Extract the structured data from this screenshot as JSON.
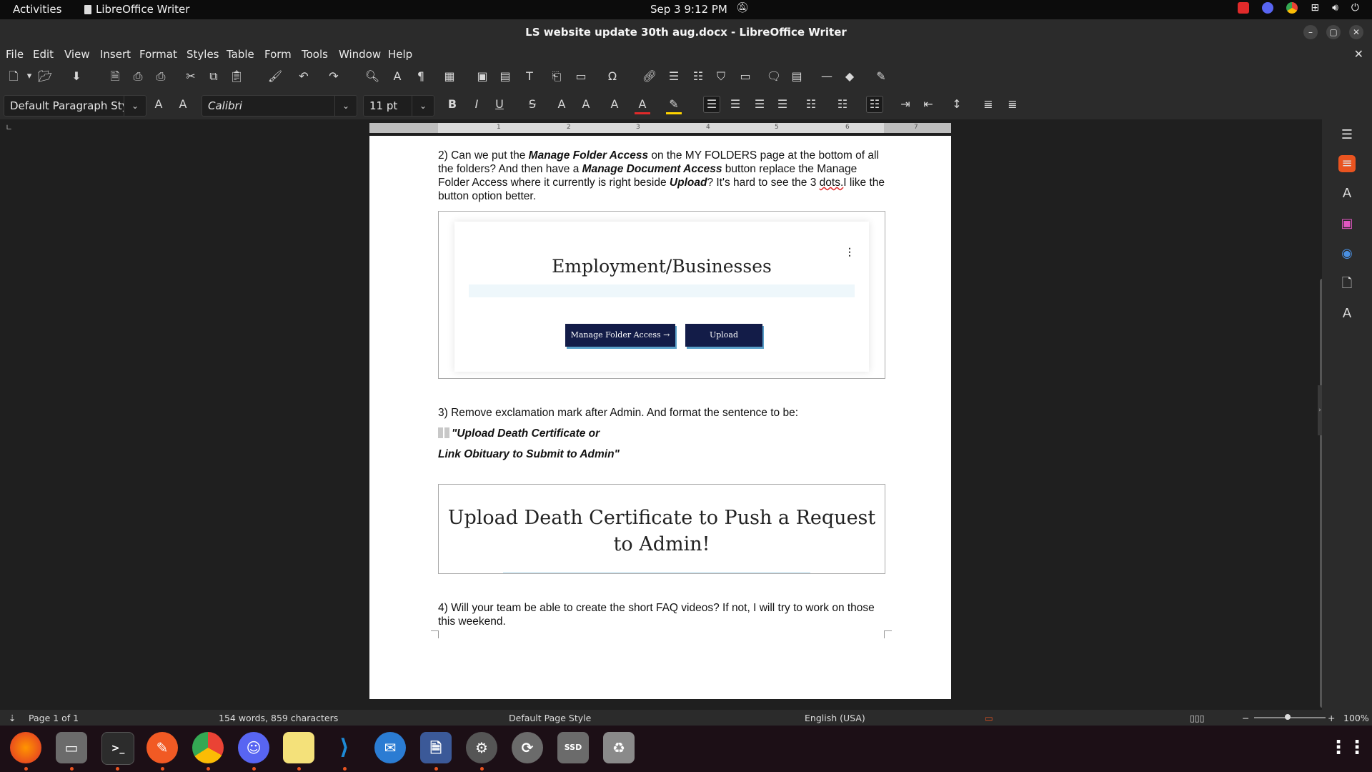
{
  "topbar": {
    "activities": "Activities",
    "app_name": "LibreOffice Writer",
    "clock": "Sep 3  9:12 PM"
  },
  "window": {
    "title": "LS website update 30th aug.docx - LibreOffice Writer"
  },
  "menu": [
    "File",
    "Edit",
    "View",
    "Insert",
    "Format",
    "Styles",
    "Table",
    "Form",
    "Tools",
    "Window",
    "Help"
  ],
  "toolbar": {
    "paragraph_style": "Default Paragraph Styl",
    "font_name": "Calibri",
    "font_size": "11 pt"
  },
  "document": {
    "p2": {
      "prefix": "2) Can we put the ",
      "bold1": "Manage Folder Access",
      "mid1": " on the MY FOLDERS page at the bottom of all the folders? And then have a ",
      "bold2": "Manage Document Access",
      "mid2": " button replace the Manage Folder Access where it currently is right beside ",
      "bold3": "Upload",
      "tail1": "? It's hard to see the 3 ",
      "misspelled": "dots.",
      "tail2": "I like the button option better."
    },
    "embed1": {
      "title": "Employment/Businesses",
      "button1": "Manage Folder Access →",
      "button2": "Upload"
    },
    "p3": {
      "line1": "3) Remove exclamation mark after Admin. And format the sentence to be:",
      "quote1": "\"Upload Death Certificate or",
      "quote2": "Link Obituary to Submit to Admin\""
    },
    "embed2": {
      "title": "Upload Death Certificate to Push a Request to Admin!"
    },
    "p4": {
      "text": "4) Will your team be able to create the short FAQ videos? If not, I will try to work on those this weekend."
    }
  },
  "statusbar": {
    "page": "Page 1 of 1",
    "words": "154 words, 859 characters",
    "page_style": "Default Page Style",
    "language": "English (USA)",
    "zoom": "100%"
  },
  "colors": {
    "button_navy": "#131c48",
    "accent_orange": "#e95420"
  }
}
